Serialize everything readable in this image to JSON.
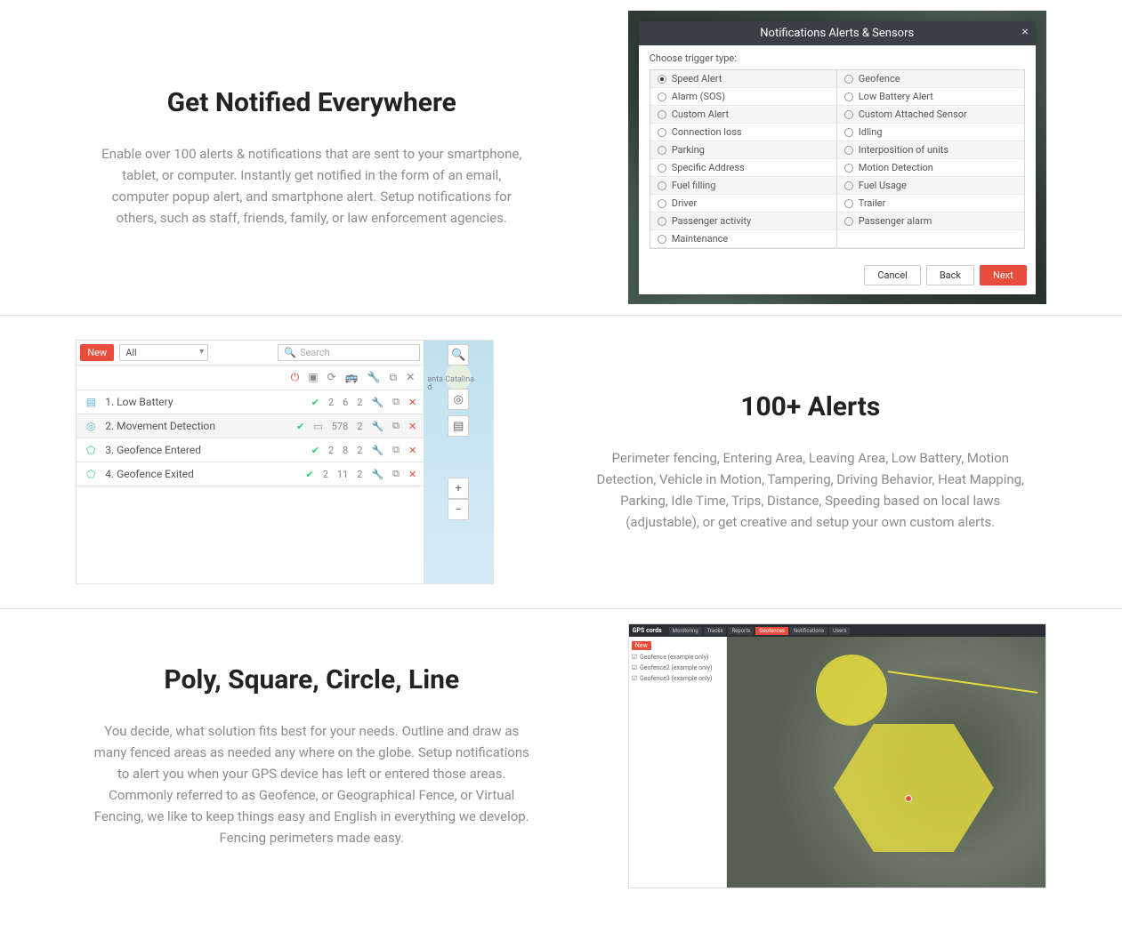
{
  "section1": {
    "heading": "Get Notified Everywhere",
    "body": "Enable over 100 alerts & notifications that are sent to your smartphone, tablet, or computer. Instantly get notified in the form of an email, computer popup alert, and smartphone alert. Setup notifications for others, such as staff, friends, family, or law enforcement agencies.",
    "dialog": {
      "title": "Notifications Alerts & Sensors",
      "close": "×",
      "label": "Choose trigger type:",
      "triggers_left": [
        "Speed Alert",
        "Alarm (SOS)",
        "Custom Alert",
        "Connection loss",
        "Parking",
        "Specific Address",
        "Fuel filling",
        "Driver",
        "Passenger activity",
        "Maintenance"
      ],
      "triggers_right": [
        "Geofence",
        "Low Battery Alert",
        "Custom Attached Sensor",
        "Idling",
        "Interposition of units",
        "Motion Detection",
        "Fuel Usage",
        "Trailer",
        "Passenger alarm",
        ""
      ],
      "selected": "Speed Alert",
      "buttons": {
        "cancel": "Cancel",
        "back": "Back",
        "next": "Next"
      }
    }
  },
  "section2": {
    "heading": "100+ Alerts",
    "body": "Perimeter fencing, Entering Area, Leaving Area, Low Battery, Motion Detection, Vehicle in Motion, Tampering, Driving Behavior, Heat Mapping, Parking, Idle Time, Trips, Distance, Speeding based on local laws (adjustable), or get creative and setup your own custom alerts.",
    "panel": {
      "new_label": "New",
      "filter_label": "All",
      "search_placeholder": "Search",
      "island_label": "anta Catalina\nd",
      "rows": [
        {
          "name": "1. Low Battery",
          "a": "2",
          "b": "6",
          "c": "2"
        },
        {
          "name": "2. Movement Detection",
          "a": "",
          "b": "578",
          "c": "2"
        },
        {
          "name": "3. Geofence Entered",
          "a": "2",
          "b": "8",
          "c": "2"
        },
        {
          "name": "4. Geofence Exited",
          "a": "2",
          "b": "11",
          "c": "2"
        }
      ]
    }
  },
  "section3": {
    "heading": "Poly, Square, Circle, Line",
    "body": "You decide, what solution fits best for your needs. Outline and draw as many fenced areas as needed any where on the globe. Setup notifications to alert you when your GPS device has left or entered those areas. Commonly referred to as Geofence, or Geographical Fence, or Virtual Fencing, we like to keep things easy and English in everything we develop. Fencing perimeters made easy.",
    "app": {
      "logo": "GPS cords",
      "tabs": [
        "Monitoring",
        "Tracks",
        "Reports",
        "Geofences",
        "Notifications",
        "Users"
      ],
      "active_tab": "Geofences",
      "side_items": [
        "Geofence (example only)",
        "Geofence2 (example only)",
        "Geofence3 (example only)"
      ]
    }
  }
}
